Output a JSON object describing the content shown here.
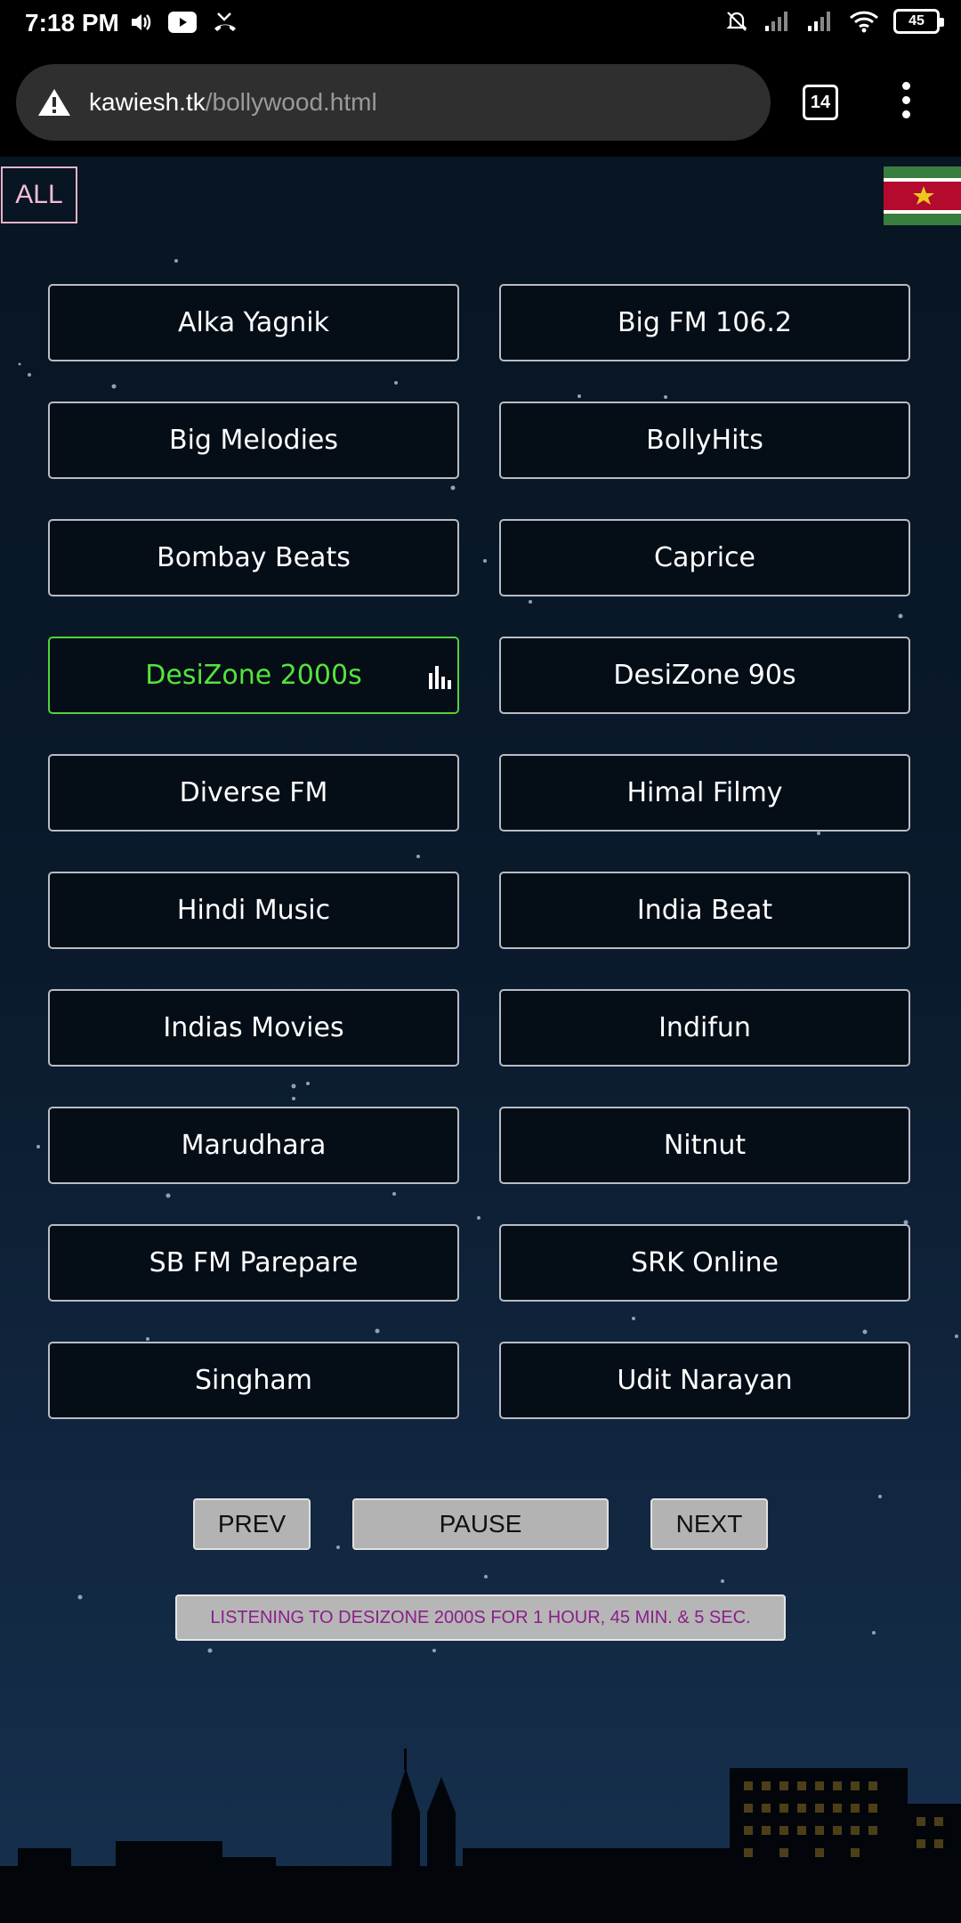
{
  "status_bar": {
    "time": "7:18 PM",
    "battery": "45",
    "left_icons": [
      "volume-icon",
      "youtube-icon",
      "missed-call-icon"
    ],
    "right_icons": [
      "bell-off-icon",
      "signal-icon",
      "signal-icon",
      "wifi-icon",
      "battery-icon"
    ]
  },
  "browser": {
    "url_host": "kawiesh.tk",
    "url_path": "/bollywood.html",
    "tab_count": "14",
    "security_icon": "warning-icon"
  },
  "page": {
    "all_label": "ALL",
    "flag": "suriname-flag",
    "stations": [
      "Alka Yagnik",
      "Big FM 106.2",
      "Big Melodies",
      "BollyHits",
      "Bombay Beats",
      "Caprice",
      "DesiZone 2000s",
      "DesiZone 90s",
      "Diverse FM",
      "Himal Filmy",
      "Hindi Music",
      "India Beat",
      "Indias Movies",
      "Indifun",
      "Marudhara",
      "Nitnut",
      "SB FM Parepare",
      "SRK Online",
      "Singham",
      "Udit Narayan"
    ],
    "active_station": "DesiZone 2000s",
    "controls": {
      "prev": "PREV",
      "pause": "PAUSE",
      "next": "NEXT"
    },
    "listening_text": "LISTENING TO DESIZONE 2000S FOR 1 HOUR, 45 MIN. & 5 SEC."
  },
  "colors": {
    "active": "#55e33c",
    "all_border": "#e5b3c8",
    "banner_text": "#8a1f8a"
  }
}
